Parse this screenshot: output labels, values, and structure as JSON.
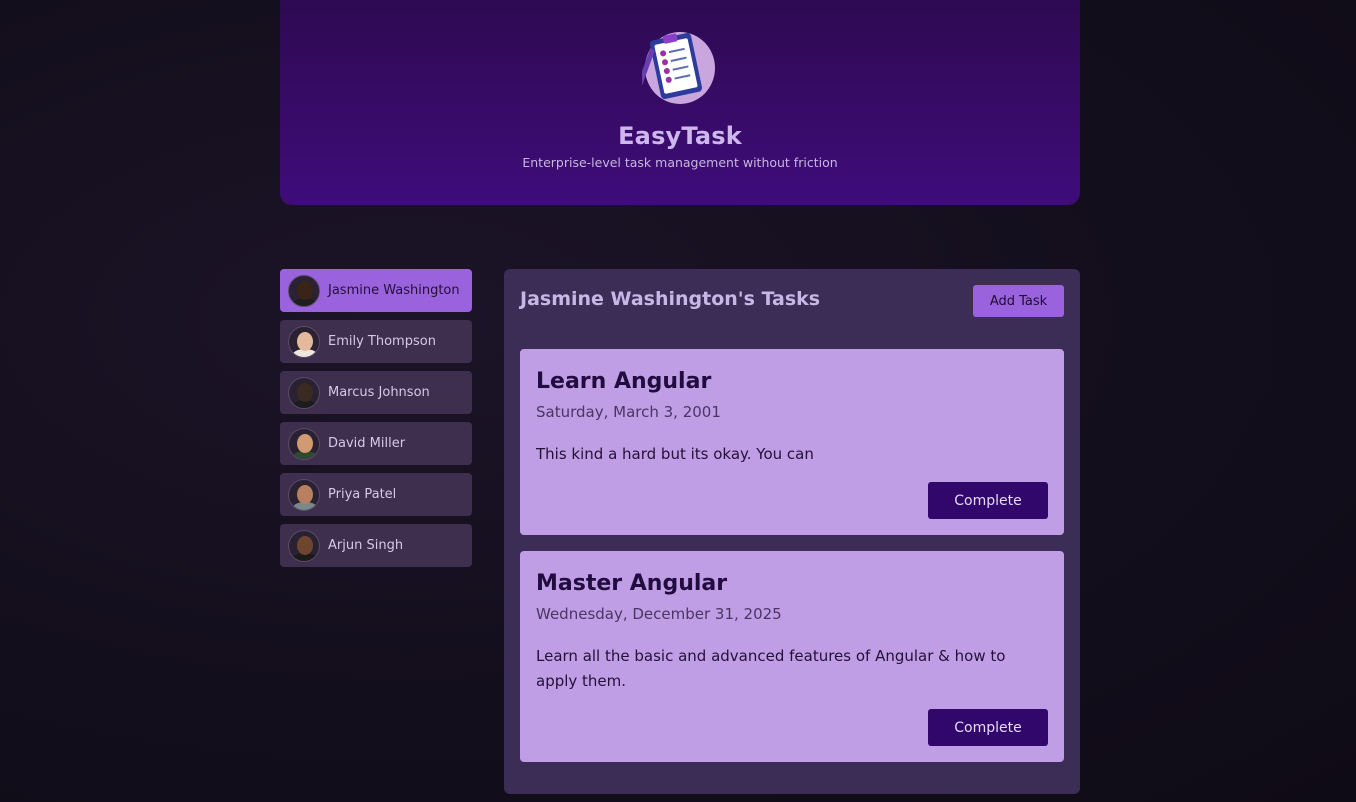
{
  "header": {
    "title": "EasyTask",
    "subtitle": "Enterprise-level task management without friction",
    "logo_icon": "clipboard-checklist-icon"
  },
  "users": [
    {
      "name": "Jasmine Washington",
      "active": true,
      "skin": "#3a2418",
      "shirt": "#1e1e1e"
    },
    {
      "name": "Emily Thompson",
      "active": false,
      "skin": "#e5b99b",
      "shirt": "#f1e6dc"
    },
    {
      "name": "Marcus Johnson",
      "active": false,
      "skin": "#3b2a22",
      "shirt": "#1c1c1c"
    },
    {
      "name": "David Miller",
      "active": false,
      "skin": "#d19a72",
      "shirt": "#2f4b2f"
    },
    {
      "name": "Priya Patel",
      "active": false,
      "skin": "#b8805e",
      "shirt": "#7a8a88"
    },
    {
      "name": "Arjun Singh",
      "active": false,
      "skin": "#6e4630",
      "shirt": "#1b1b1b"
    }
  ],
  "tasks_panel": {
    "title": "Jasmine Washington's Tasks",
    "add_label": "Add Task",
    "tasks": [
      {
        "title": "Learn Angular",
        "date": "Saturday, March 3, 2001",
        "summary": "This kind a hard but its okay. You can",
        "complete_label": "Complete"
      },
      {
        "title": "Master Angular",
        "date": "Wednesday, December 31, 2025",
        "summary": "Learn all the basic and advanced features of Angular & how to apply them.",
        "complete_label": "Complete"
      }
    ]
  },
  "colors": {
    "accent": "#9b62dd",
    "header_bg": "#3f0c7a",
    "task_bg": "#bf9ee5",
    "button_dark": "#32076b"
  }
}
